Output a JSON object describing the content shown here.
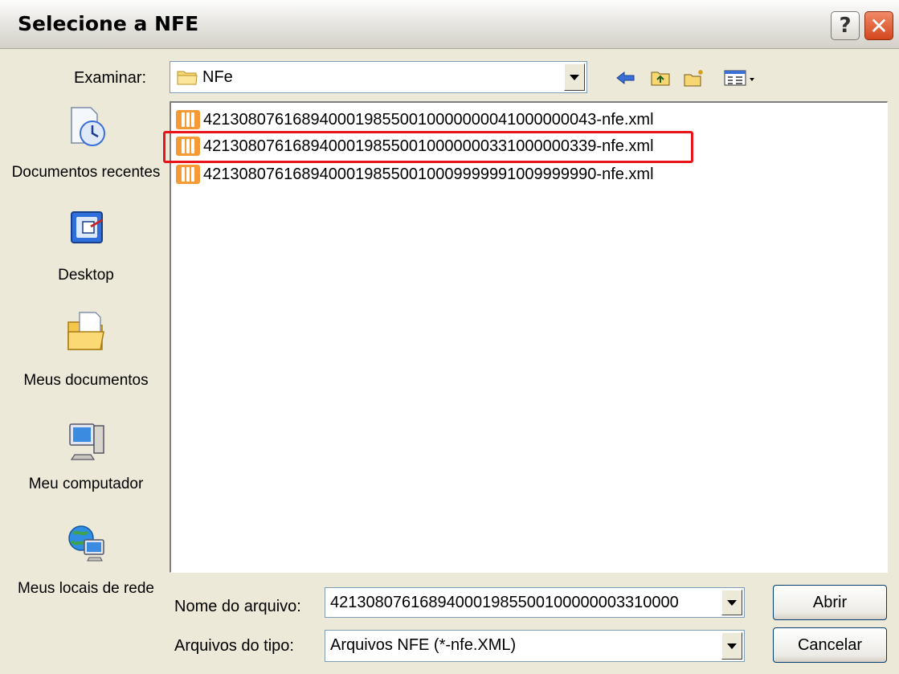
{
  "window": {
    "title": "Selecione a NFE",
    "help_symbol": "?",
    "close_symbol": "✕"
  },
  "lookin": {
    "label": "Examinar:",
    "value": "NFe"
  },
  "toolbar": {
    "icons": [
      "back-arrow-icon",
      "up-folder-icon",
      "new-folder-icon",
      "view-menu-icon"
    ]
  },
  "places": [
    {
      "label": "Documentos recentes",
      "icon": "recent-documents-icon"
    },
    {
      "label": "Desktop",
      "icon": "desktop-icon"
    },
    {
      "label": "Meus documentos",
      "icon": "my-documents-icon"
    },
    {
      "label": "Meu computador",
      "icon": "my-computer-icon"
    },
    {
      "label": "Meus locais de rede",
      "icon": "network-places-icon"
    }
  ],
  "files": [
    {
      "name": "42130807616894000198550010000000041000000043-nfe.xml"
    },
    {
      "name": "42130807616894000198550010000000331000000339-nfe.xml"
    },
    {
      "name": "42130807616894000198550010009999991009999990-nfe.xml"
    }
  ],
  "filename": {
    "label": "Nome do arquivo:",
    "value": "421308076168940001985500100000003310000"
  },
  "filetype": {
    "label": "Arquivos do tipo:",
    "value": "Arquivos NFE (*-nfe.XML)"
  },
  "buttons": {
    "open": "Abrir",
    "cancel": "Cancelar"
  },
  "colors": {
    "highlight": "#e8141a",
    "xml_icon": "#f49b36",
    "close_button": "#d4461c"
  }
}
